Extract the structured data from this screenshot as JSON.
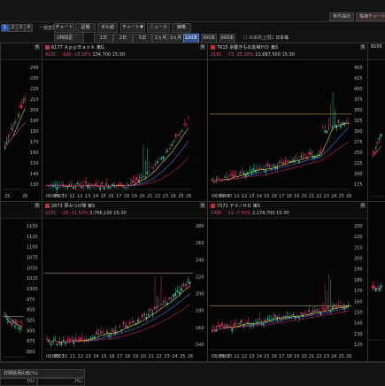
{
  "topbar": {
    "btn1": "条件抽出",
    "btn2": "株価チャート"
  },
  "toolbar": {
    "pages": [
      "1",
      "2",
      "3",
      "4"
    ],
    "active_page": "1",
    "list_label": "一括変更",
    "buttons": [
      "チャート",
      "足種",
      "ボル値",
      "チャート▼",
      "ニュース",
      "価格"
    ],
    "period_select": "1時間足",
    "range_buttons": [
      "1日",
      "2日",
      "5日",
      "1ヵ月",
      "3ヵ月",
      "100本",
      "300本",
      "600本"
    ],
    "active_range": "100本",
    "checkbox1": "出来高上限",
    "checkbox2": "日本株"
  },
  "panels": {
    "p1": {
      "id": "",
      "name": "",
      "change": "",
      "price": ""
    },
    "p2": {
      "id": "6177",
      "name": "ＡｐｐＢａｎｋ",
      "market": "東G",
      "change": "422C　-100 -19.16%",
      "volume": "134,700",
      "time": "15:30"
    },
    "p3": {
      "id": "7615",
      "name": "京都きもの友禅ＨＤ",
      "market": "東S",
      "change": "216C　-73 -25.26%",
      "volume": "11,687,500",
      "time": "15:30"
    },
    "p4": {
      "id": "8105",
      "name": "",
      "change": ""
    },
    "p5": {
      "id": "2673",
      "name": "夢みつけ隊",
      "market": "東S",
      "change": "215C　-28 -11.52%",
      "volume": "3,766,100",
      "time": "15:30"
    },
    "p6": {
      "id": "7571",
      "name": "ヤマノＨＤ",
      "market": "東S",
      "change": "148C　-12 -7.50%",
      "volume": "2,176,700",
      "time": "15:30"
    }
  },
  "axes": {
    "p1_y": [
      "240",
      "230",
      "220",
      "210",
      "200",
      "190",
      "180",
      "170",
      "160",
      "150",
      "140",
      "130"
    ],
    "p1_x": [
      "25",
      "26"
    ],
    "p2_x": [
      "08/0507",
      "09",
      "10",
      "11",
      "12",
      "13",
      "14",
      "15",
      "16",
      "17",
      "18",
      "19",
      "20",
      "21",
      "22",
      "23",
      "24",
      "25",
      "26"
    ],
    "p3_y": [
      "450",
      "425",
      "400",
      "375",
      "350",
      "325",
      "300",
      "275",
      "250",
      "225",
      "200",
      "175"
    ],
    "p3_x": [
      "08/0507",
      "09",
      "10",
      "11",
      "12",
      "13",
      "14",
      "15",
      "16",
      "17",
      "18",
      "19",
      "20",
      "21",
      "22",
      "23",
      "24",
      "25",
      "26"
    ],
    "p4_x": [
      "25"
    ],
    "p4_y": [
      "340",
      "320",
      "300",
      "280",
      "260",
      "240",
      "220",
      "200",
      "180",
      "160",
      "140"
    ],
    "p1b_y": [
      "1150",
      "1125",
      "1100",
      "1075",
      "1050",
      "1025",
      "1000",
      "975",
      "950",
      "925",
      "900",
      "875",
      "850"
    ],
    "p5_y": [
      "280",
      "260",
      "240",
      "220",
      "200",
      "180",
      "160",
      "140"
    ],
    "p5_x": [
      "08/0507",
      "09",
      "10",
      "11",
      "12",
      "13",
      "14",
      "15",
      "16",
      "17",
      "18",
      "19",
      "20",
      "21",
      "22",
      "23",
      "24",
      "25",
      "26"
    ],
    "p6_y": [
      "230",
      "220",
      "210",
      "200",
      "190",
      "180",
      "170",
      "160",
      "150",
      "140",
      "130",
      "120"
    ],
    "p6_x": [
      "08/0507",
      "09",
      "10",
      "11",
      "12",
      "13",
      "14",
      "15",
      "16",
      "17",
      "18",
      "19",
      "20",
      "21",
      "22",
      "23",
      "24",
      "25",
      "26"
    ],
    "p4b_y": [
      "360",
      "340",
      "320",
      "300",
      "280",
      "260",
      "240",
      "220"
    ]
  },
  "bottombar": {
    "tab": "詳細銘柄比較(%)",
    "box1": "(%)",
    "box2": "(%)"
  },
  "colors": {
    "up": "#2ec4a8",
    "down": "#e0306a",
    "ma1": "#e8d020",
    "ma2": "#3f7be0",
    "ma3": "#c02060",
    "line": "#ffffff"
  }
}
